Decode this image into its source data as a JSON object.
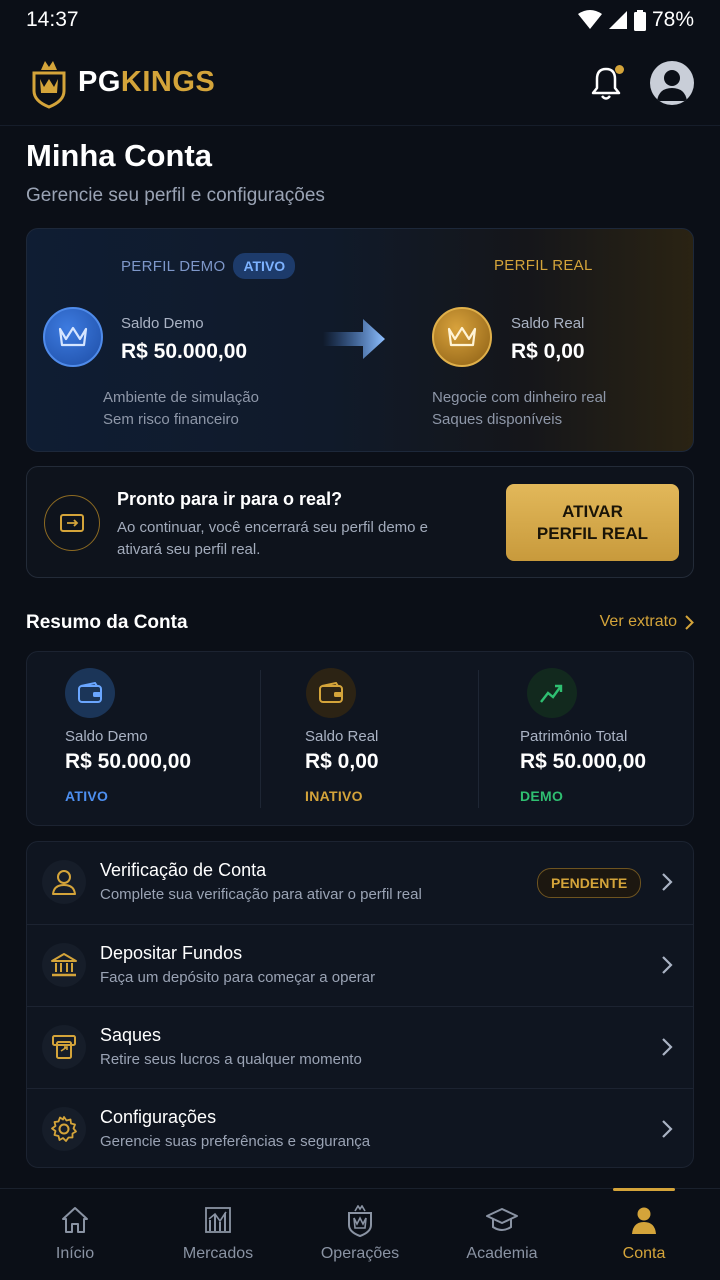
{
  "status_bar": {
    "time": "14:37",
    "battery": "78%"
  },
  "header": {
    "brand_pg": "PG",
    "brand_kings": "KINGS"
  },
  "page": {
    "title": "Minha Conta",
    "subtitle": "Gerencie seu perfil e configurações"
  },
  "profiles": {
    "demo": {
      "header": "PERFIL DEMO",
      "badge": "ATIVO",
      "balance_label": "Saldo Demo",
      "balance_value": "R$ 50.000,00",
      "desc_line1": "Ambiente de simulação",
      "desc_line2": "Sem risco financeiro"
    },
    "real": {
      "header": "PERFIL REAL",
      "balance_label": "Saldo Real",
      "balance_value": "R$ 0,00",
      "desc_line1": "Negocie com dinheiro real",
      "desc_line2": "Saques disponíveis"
    }
  },
  "cta": {
    "title": "Pronto para ir para o real?",
    "text": "Ao continuar, você encerrará seu perfil demo e ativará seu perfil real.",
    "button_line1": "ATIVAR",
    "button_line2": "PERFIL REAL"
  },
  "summary": {
    "title": "Resumo da Conta",
    "link": "Ver extrato",
    "items": [
      {
        "label": "Saldo Demo",
        "value": "R$ 50.000,00",
        "status": "ATIVO",
        "status_color": "#4d8ff0",
        "icon": "wallet-icon"
      },
      {
        "label": "Saldo Real",
        "value": "R$ 0,00",
        "status": "INATIVO",
        "status_color": "#d4a43a",
        "icon": "wallet-icon"
      },
      {
        "label": "Patrimônio Total",
        "value": "R$ 50.000,00",
        "status": "DEMO",
        "status_color": "#2fbf71",
        "icon": "chart-growth-icon"
      }
    ]
  },
  "menu": [
    {
      "title": "Verificação de Conta",
      "subtitle": "Complete sua verificação para ativar o perfil real",
      "badge": "PENDENTE",
      "icon": "user-icon"
    },
    {
      "title": "Depositar Fundos",
      "subtitle": "Faça um depósito para começar a operar",
      "icon": "bank-icon"
    },
    {
      "title": "Saques",
      "subtitle": "Retire seus lucros a qualquer momento",
      "icon": "withdraw-icon"
    },
    {
      "title": "Configurações",
      "subtitle": "Gerencie suas preferências e segurança",
      "icon": "gear-icon"
    }
  ],
  "bottom_nav": [
    {
      "label": "Início",
      "icon": "home-icon"
    },
    {
      "label": "Mercados",
      "icon": "markets-icon"
    },
    {
      "label": "Operações",
      "icon": "operations-icon"
    },
    {
      "label": "Academia",
      "icon": "graduation-cap-icon"
    },
    {
      "label": "Conta",
      "icon": "account-icon",
      "active": true
    }
  ],
  "colors": {
    "accent_gold": "#d4a43a",
    "accent_blue": "#4d8ff0",
    "success_green": "#2fbf71",
    "background": "#0b0f17"
  }
}
